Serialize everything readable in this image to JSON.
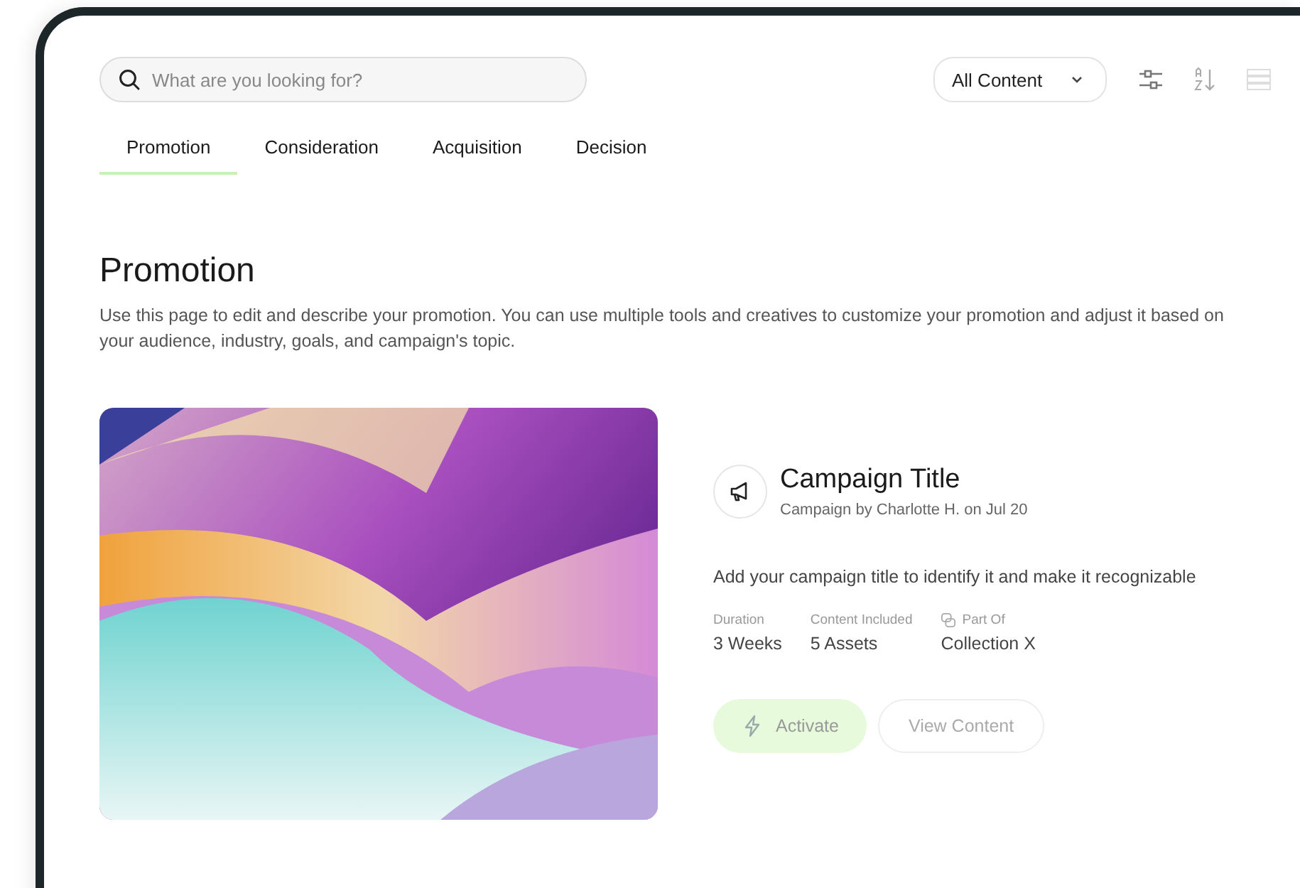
{
  "search": {
    "placeholder": "What are you looking for?"
  },
  "filter": {
    "value": "All Content"
  },
  "tabs": [
    {
      "label": "Promotion",
      "selected": true
    },
    {
      "label": "Consideration",
      "selected": false
    },
    {
      "label": "Acquisition",
      "selected": false
    },
    {
      "label": "Decision",
      "selected": false
    }
  ],
  "page": {
    "title": "Promotion",
    "description": "Use this page to edit and describe your promotion. You can use multiple tools and creatives to customize your promotion and adjust it based on your audience, industry, goals, and campaign's topic."
  },
  "campaign": {
    "title": "Campaign Title",
    "byline": "Campaign by Charlotte H. on Jul 20",
    "description": "Add your campaign title to identify it and make it recognizable",
    "stats": [
      {
        "kind": "plain",
        "label": "Duration",
        "value": "3  Weeks"
      },
      {
        "kind": "plain",
        "label": "Content Included",
        "value": "5 Assets"
      },
      {
        "kind": "linked",
        "label": "Part Of",
        "value": "Collection X"
      }
    ],
    "buttons": [
      {
        "kind": "primary",
        "label": "Activate"
      },
      {
        "kind": "secondary",
        "label": "View Content"
      }
    ]
  }
}
